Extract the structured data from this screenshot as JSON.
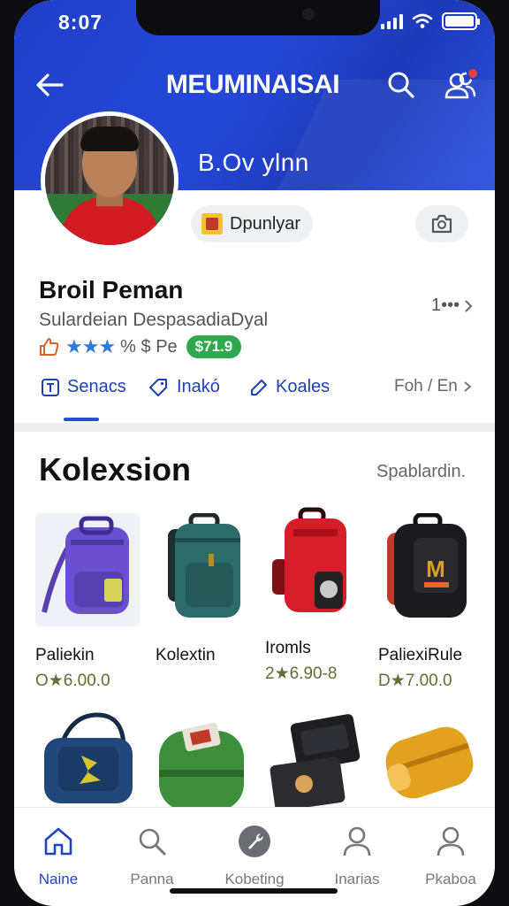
{
  "status_bar": {
    "time": "8:07"
  },
  "header": {
    "title": "MEUMINAISAI"
  },
  "profile": {
    "name": "B.Ov ylnn",
    "badge_label": "Dpunlyar",
    "shop_title": "Broil Peman",
    "shop_subtitle": "Sulardeian DespasadiaDyal",
    "more_label": "1•••",
    "rating_text": "% $ Pe",
    "price_tag": "$71.9"
  },
  "tabs": [
    {
      "label": "Senacs"
    },
    {
      "label": "Inakó"
    },
    {
      "label": "Koales"
    }
  ],
  "tab_more": "Foh / En",
  "collection": {
    "title": "Kolexsion",
    "link": "Spablardin."
  },
  "products": [
    {
      "name": "Paliekin",
      "price": "O★6.00.0"
    },
    {
      "name": "Kolextin",
      "price": ""
    },
    {
      "name": "Iromls",
      "price": "2★6.90-8"
    },
    {
      "name": "PaliexiRule",
      "price": "D★7.00.0"
    }
  ],
  "bottom_nav": [
    {
      "label": "Naine"
    },
    {
      "label": "Panna"
    },
    {
      "label": "Kobeting"
    },
    {
      "label": "Inarias"
    },
    {
      "label": "Pkaboa"
    }
  ],
  "colors": {
    "header_blue": "#1f3fc8",
    "accent_blue": "#1e3fb8",
    "price_green": "#2fa84f",
    "notification_red": "#e8413a"
  }
}
